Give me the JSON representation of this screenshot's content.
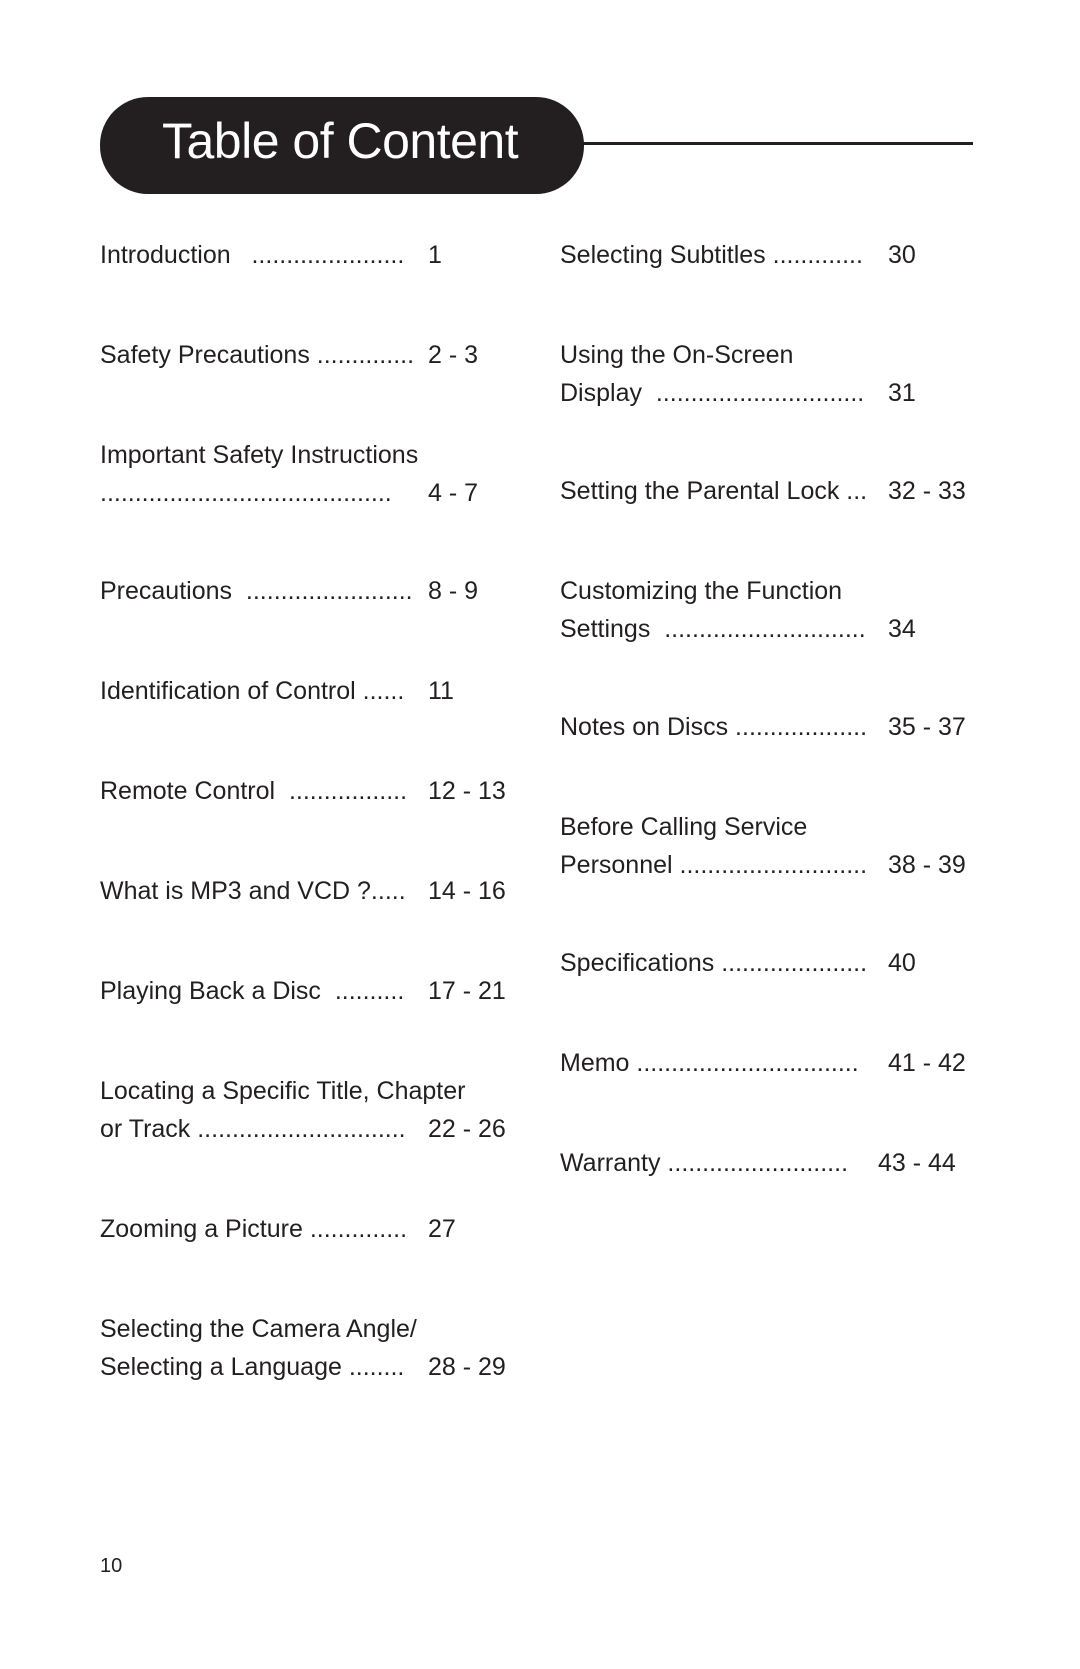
{
  "header": {
    "title": "Table of Content"
  },
  "left_column": [
    {
      "lines": [
        "Introduction   ......................"
      ],
      "page": "1"
    },
    {
      "lines": [
        "Safety Precautions .............."
      ],
      "page": "2 - 3"
    },
    {
      "lines": [
        "Important Safety Instructions",
        ".........................................."
      ],
      "page": "4 - 7"
    },
    {
      "lines": [
        "Precautions  ........................"
      ],
      "page": "8 - 9"
    },
    {
      "lines": [
        "Identification of Control ......"
      ],
      "page": "11"
    },
    {
      "lines": [
        "Remote Control  ................."
      ],
      "page": "12 - 13"
    },
    {
      "lines": [
        "What is MP3 and VCD ?....."
      ],
      "page": "14 - 16"
    },
    {
      "lines": [
        "Playing Back a Disc  .........."
      ],
      "page": "17 - 21"
    },
    {
      "lines": [
        "Locating a Specific Title, Chapter",
        "or Track .............................."
      ],
      "page": "22 - 26"
    },
    {
      "lines": [
        "Zooming a Picture .............."
      ],
      "page": "27"
    },
    {
      "lines": [
        "Selecting the Camera Angle/",
        "Selecting a Language ........"
      ],
      "page": "28 - 29"
    }
  ],
  "right_column": [
    {
      "lines": [
        "Selecting Subtitles ............."
      ],
      "page": "30"
    },
    {
      "lines": [
        "Using the On-Screen",
        "Display  .............................."
      ],
      "page": "31"
    },
    {
      "lines": [
        "Setting the Parental Lock ..."
      ],
      "page": "32 - 33"
    },
    {
      "lines": [
        "Customizing the Function",
        "Settings  ............................."
      ],
      "page": "34"
    },
    {
      "lines": [
        "Notes on Discs ..................."
      ],
      "page": "35 - 37"
    },
    {
      "lines": [
        "Before Calling Service",
        "Personnel ..........................."
      ],
      "page": "38 - 39"
    },
    {
      "lines": [
        "Specifications ....................."
      ],
      "page": "40"
    },
    {
      "lines": [
        "Memo ................................"
      ],
      "page": "41 - 42"
    },
    {
      "lines": [
        "Warranty .........................."
      ],
      "page": "43 - 44"
    }
  ],
  "footer": {
    "page_number": "10"
  }
}
